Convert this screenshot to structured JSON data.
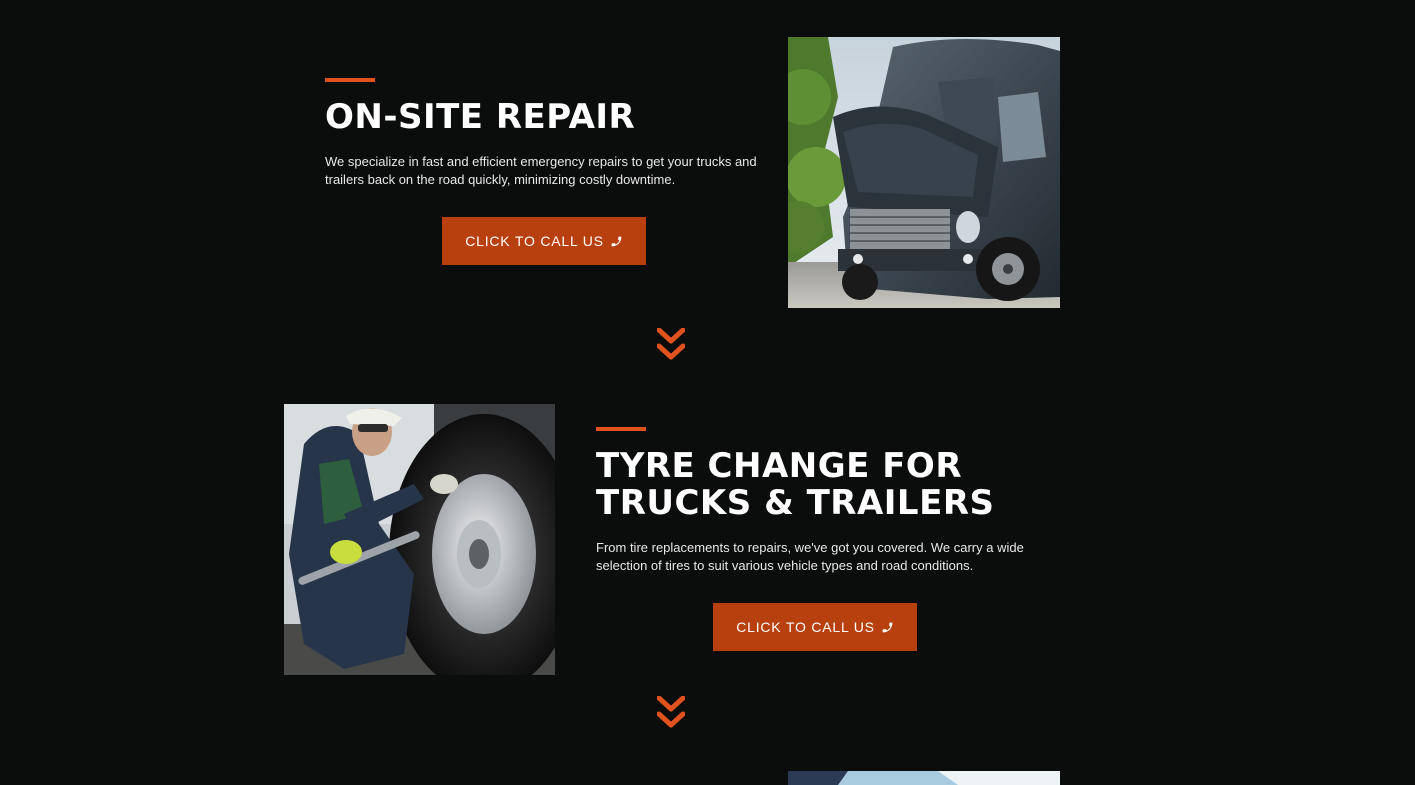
{
  "colors": {
    "background": "#0b0c0c",
    "accent": "#e0531e",
    "button": "#b8400f",
    "text": "#ffffff"
  },
  "sections": [
    {
      "title": "ON-SITE REPAIR",
      "description_line1": "We specialize in fast and efficient emergency repairs to get your trucks and",
      "description_line2": "trailers back on the road quickly, minimizing costly downtime.",
      "cta_label": "CLICK TO CALL US",
      "cta_icon": "phone-icon",
      "image": "semi-truck-with-open-hood-photo"
    },
    {
      "title_line1": "TYRE CHANGE FOR",
      "title_line2": "TRUCKS & TRAILERS",
      "description_line1": "From tire replacements to repairs, we've got you covered. We carry a wide",
      "description_line2": "selection of tires to suit various vehicle types and road conditions.",
      "cta_label": "CLICK TO CALL US",
      "cta_icon": "phone-icon",
      "image": "mechanic-changing-truck-tire-photo"
    }
  ],
  "scroll_indicator_icon": "double-chevron-down-icon"
}
